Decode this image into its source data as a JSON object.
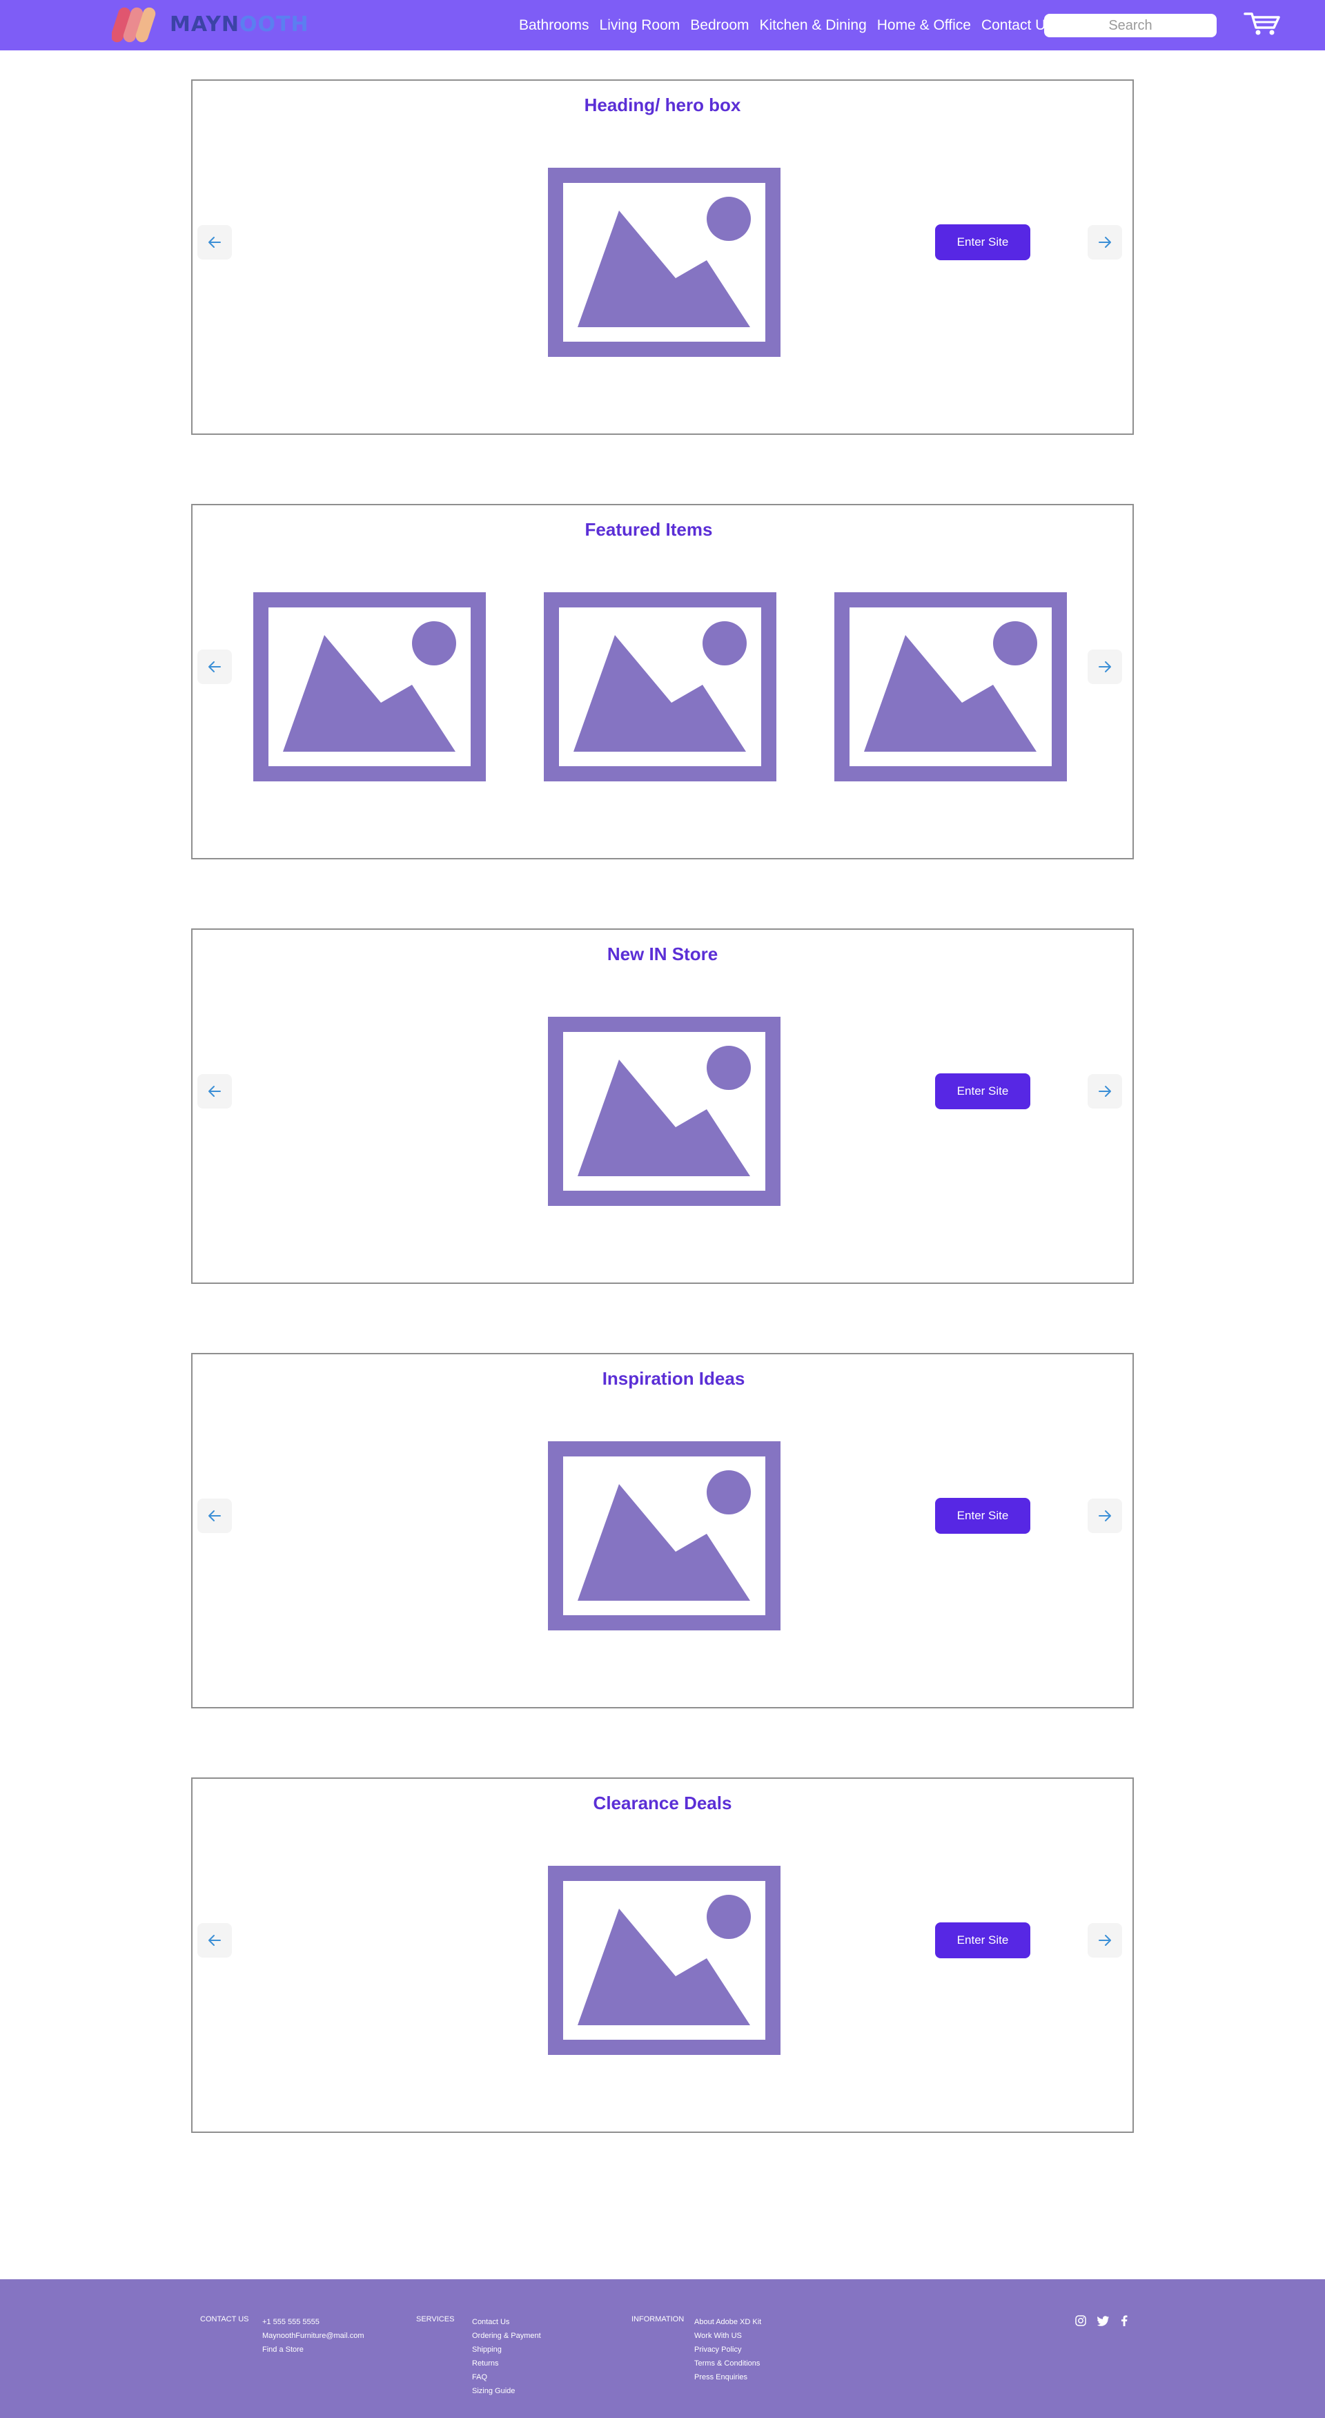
{
  "header": {
    "logo_text_a": "MAYN",
    "logo_text_b": "OOTH",
    "nav": [
      "Bathrooms",
      "Living Room",
      "Bedroom",
      "Kitchen & Dining",
      "Home & Office",
      "Contact Us"
    ],
    "search_placeholder": "Search",
    "cart_icon": "shopping-cart-icon"
  },
  "sections": [
    {
      "title": "Heading/ hero box",
      "enter_label": "Enter Site"
    },
    {
      "title": "Featured Items"
    },
    {
      "title": "New IN Store",
      "enter_label": "Enter Site"
    },
    {
      "title": "Inspiration Ideas",
      "enter_label": "Enter Site"
    },
    {
      "title": "Clearance Deals",
      "enter_label": "Enter Site"
    }
  ],
  "footer": {
    "contact_label": "CONTACT US",
    "contact_items": [
      "+1 555 555 5555",
      "MaynoothFurniture@mail.com",
      "Find a Store"
    ],
    "services_label": "SERVICES",
    "services_items": [
      "Contact Us",
      "Ordering & Payment",
      "Shipping",
      "Returns",
      "FAQ",
      "Sizing Guide"
    ],
    "information_label": "INFORMATION",
    "information_items": [
      "About Adobe XD Kit",
      "Work With US",
      "Privacy Policy",
      "Terms & Conditions",
      "Press Enquiries"
    ],
    "social_icons": [
      "instagram-icon",
      "twitter-icon",
      "facebook-icon"
    ]
  },
  "colors": {
    "header_bg": "#7E5DF6",
    "title_text": "#5b2fd6",
    "enter_button": "#5727E4",
    "placeholder_image": "#8574C2",
    "footer_bg": "#8574C2",
    "arrow": "#3b8fd6"
  }
}
